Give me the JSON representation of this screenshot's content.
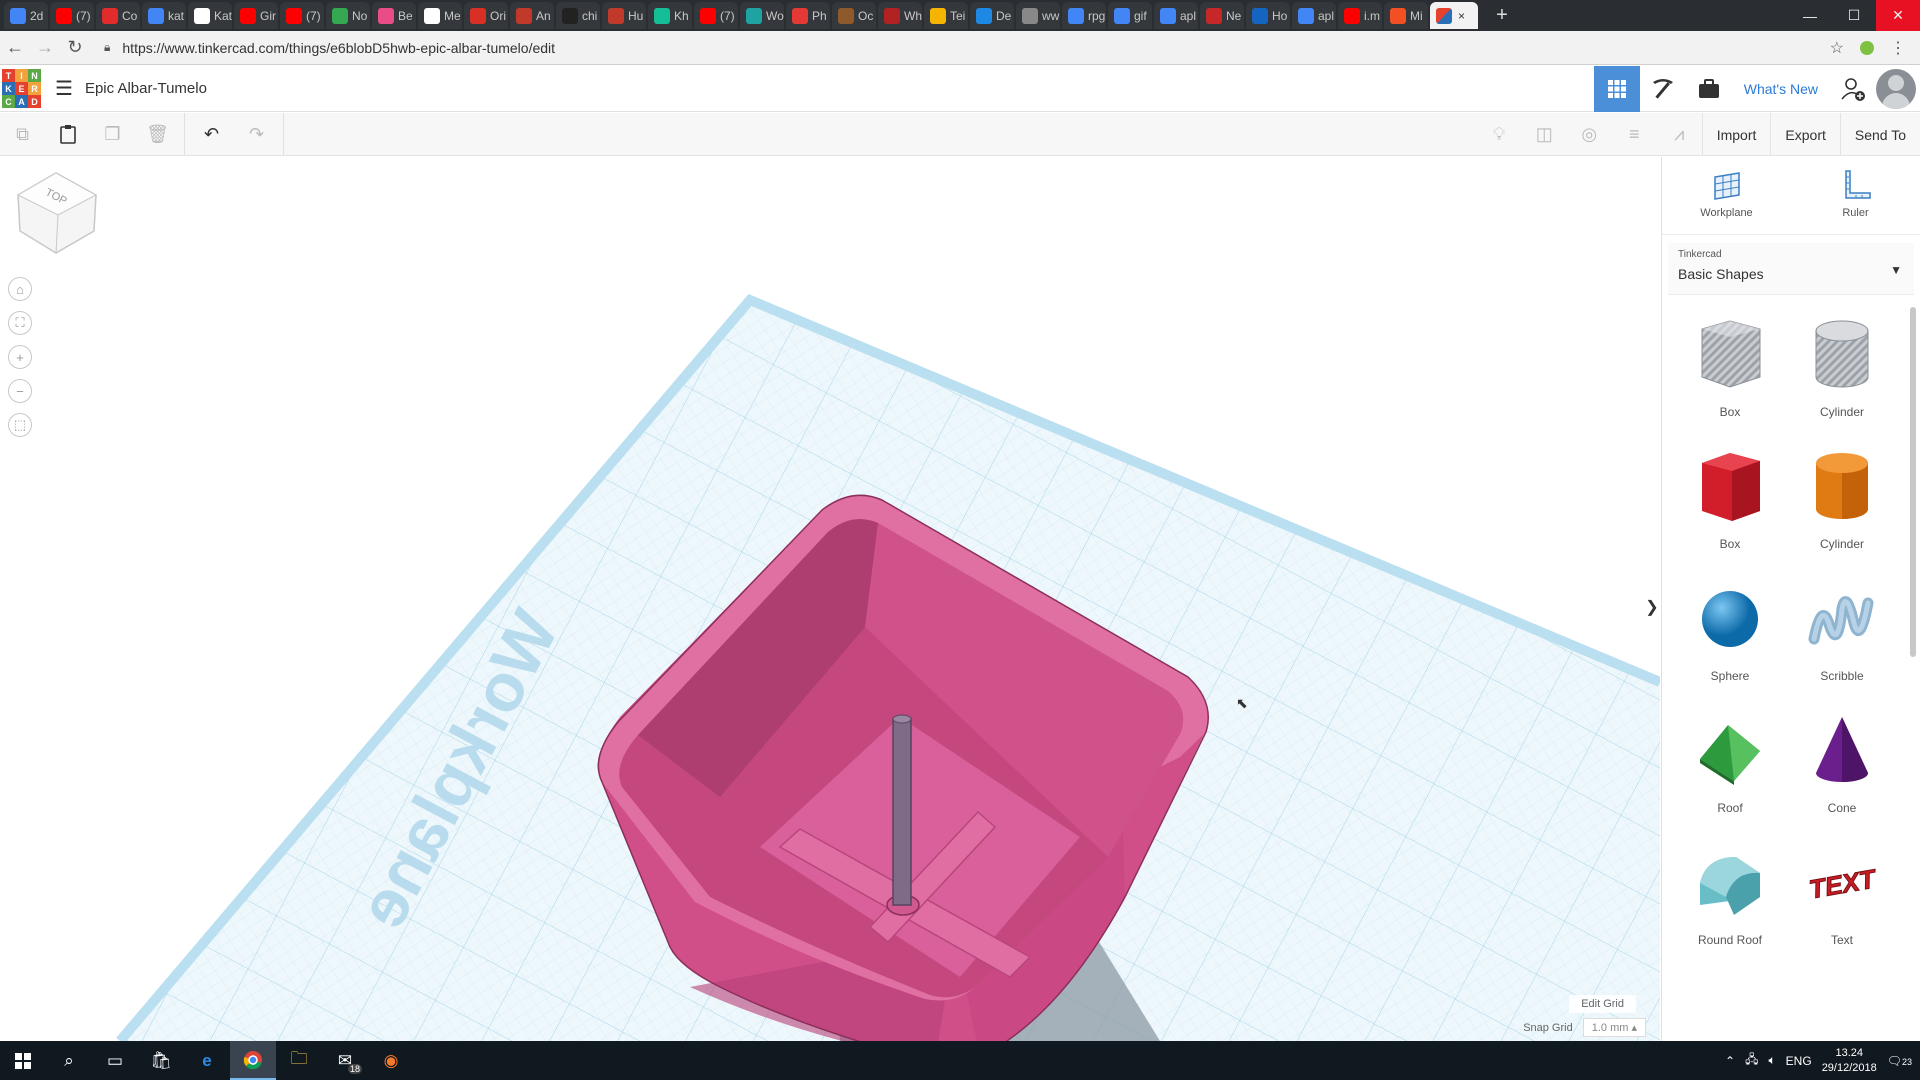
{
  "browser": {
    "tabs": [
      {
        "label": "2d",
        "color": "#4285f4"
      },
      {
        "label": "(7)",
        "color": "#ff0000"
      },
      {
        "label": "Co",
        "color": "#e22c2c"
      },
      {
        "label": "kat",
        "color": "#4285f4"
      },
      {
        "label": "Kat",
        "color": "#ffffff"
      },
      {
        "label": "Gir",
        "color": "#ff0000"
      },
      {
        "label": "(7)",
        "color": "#ff0000"
      },
      {
        "label": "No",
        "color": "#34a853"
      },
      {
        "label": "Be",
        "color": "#ea4c89"
      },
      {
        "label": "Me",
        "color": "#ffffff"
      },
      {
        "label": "Ori",
        "color": "#d93025"
      },
      {
        "label": "An",
        "color": "#c0392b"
      },
      {
        "label": "chi",
        "color": "#222222"
      },
      {
        "label": "Hu",
        "color": "#c0392b"
      },
      {
        "label": "Kh",
        "color": "#14bf96"
      },
      {
        "label": "(7)",
        "color": "#ff0000"
      },
      {
        "label": "Wo",
        "color": "#1fa2a2"
      },
      {
        "label": "Ph",
        "color": "#e53935"
      },
      {
        "label": "Oc",
        "color": "#8e5a2b"
      },
      {
        "label": "Wh",
        "color": "#b22222"
      },
      {
        "label": "Tei",
        "color": "#f4b400"
      },
      {
        "label": "De",
        "color": "#1e88e5"
      },
      {
        "label": "ww",
        "color": "#888888"
      },
      {
        "label": "rpg",
        "color": "#4285f4"
      },
      {
        "label": "gif",
        "color": "#4285f4"
      },
      {
        "label": "apl",
        "color": "#4285f4"
      },
      {
        "label": "Ne",
        "color": "#c62828"
      },
      {
        "label": "Ho",
        "color": "#1565c0"
      },
      {
        "label": "apl",
        "color": "#4285f4"
      },
      {
        "label": "i.m",
        "color": "#ff0000"
      },
      {
        "label": "Mi",
        "color": "#f25022"
      }
    ],
    "active_tab": {
      "label": "",
      "close": "×"
    },
    "new_tab": "+",
    "window": {
      "minimize": "—",
      "maximize": "☐",
      "close": "✕"
    },
    "url": "https://www.tinkercad.com/things/e6blobD5hwb-epic-albar-tumelo/edit"
  },
  "app": {
    "logo_letters": [
      "T",
      "I",
      "N",
      "K",
      "E",
      "R",
      "C",
      "A",
      "D"
    ],
    "logo_colors": [
      "#e5412d",
      "#f2a23a",
      "#5ba847",
      "#2a6fb6",
      "#e5412d",
      "#f2a23a",
      "#5ba847",
      "#2a6fb6",
      "#e5412d"
    ],
    "title": "Epic Albar-Tumelo",
    "whats_new": "What's New"
  },
  "toolbar": {
    "import": "Import",
    "export": "Export",
    "send_to": "Send To"
  },
  "viewport": {
    "workplane_label": "Workplane",
    "viewcube_top": "TOP",
    "edit_grid": "Edit Grid",
    "snap_grid_label": "Snap Grid",
    "snap_grid_value": "1.0 mm",
    "snap_arrow": "▴",
    "object_color": "#d9558f",
    "grid_color": "#a8d7ea"
  },
  "panel": {
    "workplane": "Workplane",
    "ruler": "Ruler",
    "library_sub": "Tinkercad",
    "library_main": "Basic Shapes",
    "shapes": [
      {
        "label": "Box",
        "kind": "box-hole"
      },
      {
        "label": "Cylinder",
        "kind": "cyl-hole"
      },
      {
        "label": "Box",
        "kind": "box"
      },
      {
        "label": "Cylinder",
        "kind": "cyl"
      },
      {
        "label": "Sphere",
        "kind": "sphere"
      },
      {
        "label": "Scribble",
        "kind": "scribble"
      },
      {
        "label": "Roof",
        "kind": "roof"
      },
      {
        "label": "Cone",
        "kind": "cone"
      },
      {
        "label": "Round Roof",
        "kind": "roundroof"
      },
      {
        "label": "Text",
        "kind": "text"
      }
    ],
    "text_shape_word": "TEXT"
  },
  "taskbar": {
    "lang": "ENG",
    "time": "13.24",
    "date": "29/12/2018",
    "mail_badge": "18",
    "notif_badge": "23"
  }
}
